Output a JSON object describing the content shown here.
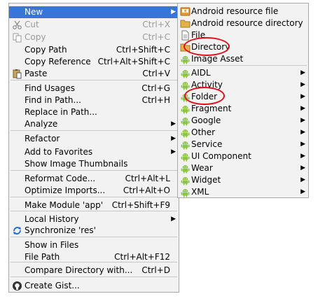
{
  "main_menu": [
    {
      "label": "New",
      "shortcut": "",
      "submenu": true,
      "highlight": true,
      "icon": "none"
    },
    {
      "label": "Cut",
      "shortcut": "Ctrl+X",
      "disabled": true,
      "icon": "scissors-icon"
    },
    {
      "label": "Copy",
      "shortcut": "Ctrl+C",
      "disabled": true,
      "icon": "copy-icon"
    },
    {
      "label": "Copy Path",
      "shortcut": "Ctrl+Shift+C",
      "icon": "none"
    },
    {
      "label": "Copy Reference",
      "shortcut": "Ctrl+Alt+Shift+C",
      "icon": "none"
    },
    {
      "label": "Paste",
      "shortcut": "Ctrl+V",
      "icon": "paste-icon"
    },
    {
      "label": "Find Usages",
      "shortcut": "Ctrl+G",
      "icon": "none"
    },
    {
      "label": "Find in Path...",
      "shortcut": "Ctrl+H",
      "icon": "none"
    },
    {
      "label": "Replace in Path...",
      "shortcut": "",
      "icon": "none"
    },
    {
      "label": "Analyze",
      "shortcut": "",
      "submenu": true,
      "icon": "none"
    },
    {
      "label": "Refactor",
      "shortcut": "",
      "submenu": true,
      "icon": "none"
    },
    {
      "label": "Add to Favorites",
      "shortcut": "",
      "submenu": true,
      "icon": "none"
    },
    {
      "label": "Show Image Thumbnails",
      "shortcut": "",
      "icon": "none"
    },
    {
      "label": "Reformat Code...",
      "shortcut": "Ctrl+Alt+L",
      "icon": "none"
    },
    {
      "label": "Optimize Imports...",
      "shortcut": "Ctrl+Alt+O",
      "icon": "none"
    },
    {
      "label": "Make Module 'app'",
      "shortcut": "Ctrl+Shift+F9",
      "icon": "none"
    },
    {
      "label": "Local History",
      "shortcut": "",
      "submenu": true,
      "icon": "none"
    },
    {
      "label": "Synchronize 'res'",
      "shortcut": "",
      "icon": "sync-icon"
    },
    {
      "label": "Show in Files",
      "shortcut": "",
      "icon": "none"
    },
    {
      "label": "File Path",
      "shortcut": "Ctrl+Alt+F12",
      "icon": "none"
    },
    {
      "label": "Compare Directory with...",
      "shortcut": "Ctrl+D",
      "icon": "none"
    },
    {
      "label": "Create Gist...",
      "shortcut": "",
      "icon": "github-icon"
    }
  ],
  "sub_menu": [
    {
      "label": "Android resource file",
      "icon": "android-resource-file-icon"
    },
    {
      "label": "Android resource directory",
      "icon": "folder-icon"
    },
    {
      "label": "File",
      "icon": "file-icon"
    },
    {
      "label": "Directory",
      "icon": "folder-icon"
    },
    {
      "label": "Image Asset",
      "icon": "android-icon"
    },
    {
      "label": "AIDL",
      "icon": "android-icon",
      "submenu": true
    },
    {
      "label": "Activity",
      "icon": "android-icon",
      "submenu": true
    },
    {
      "label": "Folder",
      "icon": "android-icon",
      "submenu": true
    },
    {
      "label": "Fragment",
      "icon": "android-icon",
      "submenu": true
    },
    {
      "label": "Google",
      "icon": "android-icon",
      "submenu": true
    },
    {
      "label": "Other",
      "icon": "android-icon",
      "submenu": true
    },
    {
      "label": "Service",
      "icon": "android-icon",
      "submenu": true
    },
    {
      "label": "UI Component",
      "icon": "android-icon",
      "submenu": true
    },
    {
      "label": "Wear",
      "icon": "android-icon",
      "submenu": true
    },
    {
      "label": "Widget",
      "icon": "android-icon",
      "submenu": true
    },
    {
      "label": "XML",
      "icon": "android-icon",
      "submenu": true
    }
  ],
  "colors": {
    "highlight": "#3875d7",
    "annotation": "#e0101a",
    "android": "#8cc63f"
  },
  "annotations": [
    "Directory",
    "Folder"
  ]
}
